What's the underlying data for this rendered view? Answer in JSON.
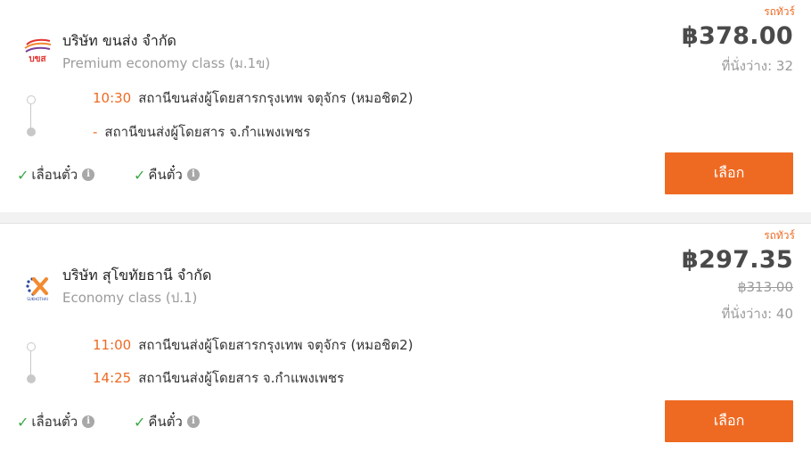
{
  "results": [
    {
      "bus_type": "รถทัวร์",
      "company": "บริษัท ขนส่ง จำกัด",
      "class_name": "Premium economy class (ม.1ข)",
      "logo_text": "บขส",
      "price": "฿378.00",
      "old_price": "",
      "seats": "ที่นั่งว่าง: 32",
      "departure_time": "10:30",
      "departure_station": "สถานีขนส่งผู้โดยสารกรุงเทพ จตุจักร (หมอชิต2)",
      "arrival_time": "-",
      "arrival_station": "สถานีขนส่งผู้โดยสาร จ.กำแพงเพชร",
      "policy_reschedule": "เลื่อนตั๋ว",
      "policy_refund": "คืนตั๋ว",
      "select_label": "เลือก"
    },
    {
      "bus_type": "รถทัวร์",
      "company": "บริษัท สุโขทัยธานี จำกัด",
      "class_name": "Economy class (ป.1)",
      "logo_text": "SUKHOTHAI",
      "price": "฿297.35",
      "old_price": "฿313.00",
      "seats": "ที่นั่งว่าง: 40",
      "departure_time": "11:00",
      "departure_station": "สถานีขนส่งผู้โดยสารกรุงเทพ จตุจักร (หมอชิต2)",
      "arrival_time": "14:25",
      "arrival_station": "สถานีขนส่งผู้โดยสาร จ.กำแพงเพชร",
      "policy_reschedule": "เลื่อนตั๋ว",
      "policy_refund": "คืนตั๋ว",
      "select_label": "เลือก"
    }
  ],
  "icons": {
    "check": "check-icon",
    "info": "info-icon"
  },
  "colors": {
    "accent": "#ee6a23",
    "check": "#3aa845",
    "muted": "#9b9b9b"
  }
}
